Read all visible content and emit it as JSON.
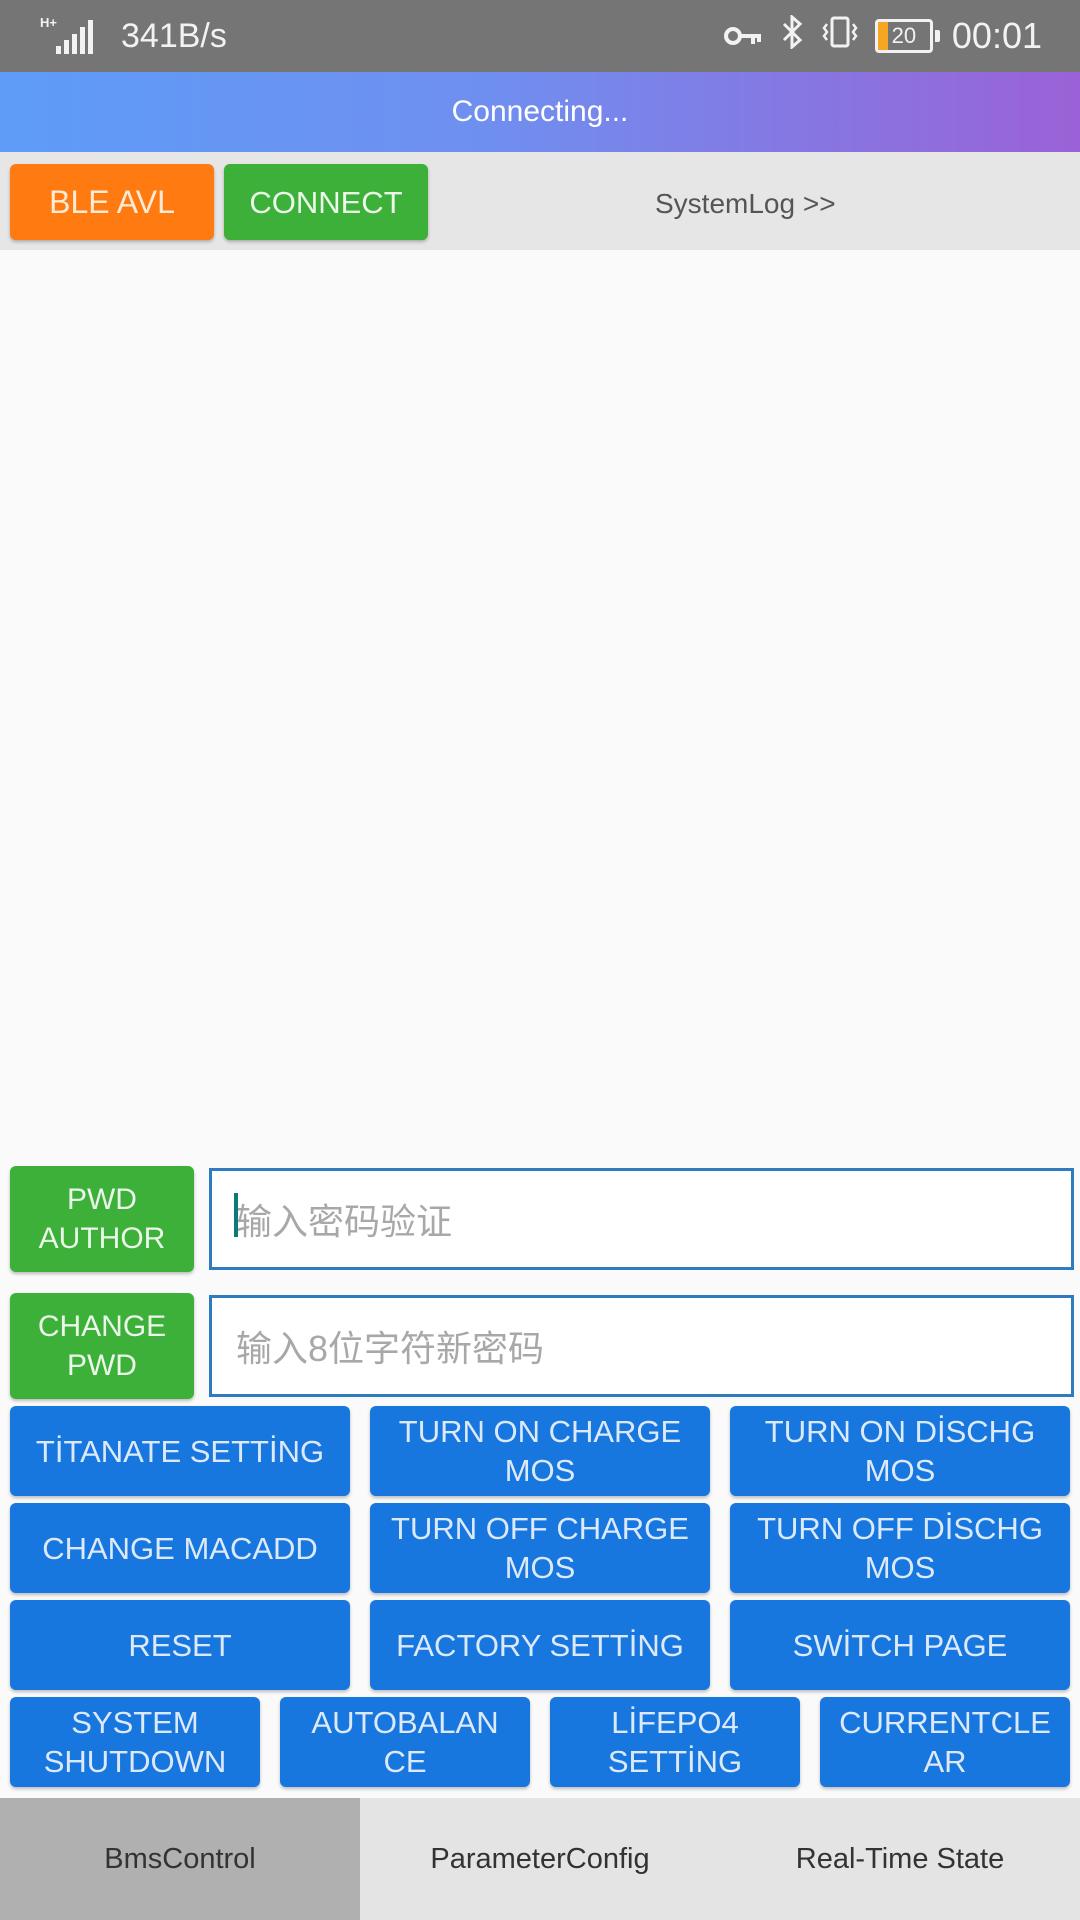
{
  "statusbar": {
    "net_speed": "341B/s",
    "network_type": "H+",
    "battery_level": "20",
    "battery_fill_fraction": 0.2,
    "time": "00:01",
    "icons": [
      "signal-icon",
      "key-icon",
      "bluetooth-icon",
      "vibrate-icon",
      "battery-icon"
    ]
  },
  "header": {
    "title": "Connecting..."
  },
  "toolbar": {
    "ble_avl_label": "BLE AVL",
    "connect_label": "CONNECT",
    "syslog_label": "SystemLog >>"
  },
  "auth": {
    "pwd_author_label": "PWD\nAUTHOR",
    "pwd_placeholder": "输入密码验证",
    "change_pwd_label": "CHANGE\nPWD",
    "new_pwd_placeholder": "输入8位字符新密码"
  },
  "controls": {
    "titanate_setting": "TİTANATE SETTİNG",
    "turn_on_charge_mos": "TURN ON CHARGE MOS",
    "turn_on_dischg_mos": "TURN ON DİSCHG MOS",
    "change_macadd": "CHANGE MACADD",
    "turn_off_charge_mos": "TURN OFF CHARGE MOS",
    "turn_off_dischg_mos": "TURN OFF DİSCHG MOS",
    "reset": "RESET",
    "factory_setting": "FACTORY SETTİNG",
    "switch_page": "SWİTCH PAGE",
    "system_shutdown": "SYSTEM SHUTDOWN",
    "autobalance": "AUTOBALAN CE",
    "lifepo4_setting": "LİFEPO4 SETTİNG",
    "currentclear": "CURRENTCLE AR"
  },
  "bottom_nav": {
    "tabs": [
      "BmsControl",
      "ParameterConfig",
      "Real-Time State"
    ],
    "active": "BmsControl"
  },
  "colors": {
    "orange": "#ff7a10",
    "green": "#3cb039",
    "blue": "#1877de",
    "header_gradient_start": "#5e9cf8",
    "header_gradient_end": "#9a62d6"
  }
}
